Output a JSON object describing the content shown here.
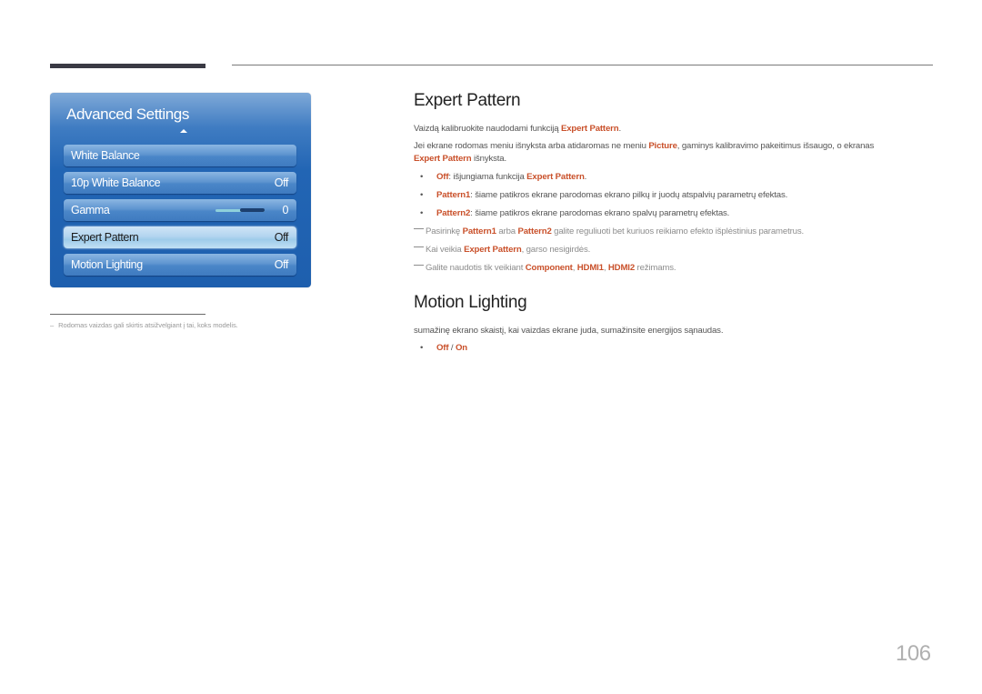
{
  "menu": {
    "title": "Advanced Settings",
    "items": [
      {
        "label": "White Balance",
        "value": ""
      },
      {
        "label": "10p White Balance",
        "value": "Off"
      },
      {
        "label": "Gamma",
        "value": "0",
        "slider_fraction": 0.5
      },
      {
        "label": "Expert Pattern",
        "value": "Off",
        "selected": true
      },
      {
        "label": "Motion Lighting",
        "value": "Off"
      }
    ]
  },
  "footnote": {
    "dash": "–",
    "text": "Rodomas vaizdas gali skirtis atsižvelgiant į tai, koks modelis."
  },
  "expert_pattern": {
    "heading": "Expert Pattern",
    "intro": {
      "pre": "Vaizdą kalibruokite naudodami funkciją ",
      "hl": "Expert Pattern",
      "post": "."
    },
    "para2": {
      "pre": "Jei ekrane rodomas meniu išnyksta arba atidaromas ne meniu ",
      "hl1": "Picture",
      "mid": ", gaminys kalibravimo pakeitimus išsaugo, o ekranas",
      "hl2": "Expert Pattern",
      "post": " išnyksta."
    },
    "bullets": [
      {
        "hl": "Off",
        "text": ": išjungiama funkcija ",
        "hl2": "Expert Pattern",
        "post": "."
      },
      {
        "hl": "Pattern1",
        "text": ": šiame patikros ekrane parodomas ekrano pilkų ir juodų atspalvių parametrų efektas."
      },
      {
        "hl": "Pattern2",
        "text": ": šiame patikros ekrane parodomas ekrano spalvų parametrų efektas."
      }
    ],
    "notes": [
      {
        "pre": "Pasirinkę ",
        "hl1": "Pattern1",
        "mid": " arba ",
        "hl2": "Pattern2",
        "post": " galite reguliuoti bet kuriuos reikiamo efekto išplėstinius parametrus."
      },
      {
        "pre": "Kai veikia ",
        "hl1": "Expert Pattern",
        "post": ", garso nesigirdės."
      },
      {
        "pre": "Galite naudotis tik veikiant ",
        "hl1": "Component",
        "sep1": ", ",
        "hl2": "HDMI1",
        "sep2": ", ",
        "hl3": "HDMI2",
        "post": " režimams."
      }
    ]
  },
  "motion_lighting": {
    "heading": "Motion Lighting",
    "desc": "sumažinę ekrano skaistį, kai vaizdas ekrane juda, sumažinsite energijos sąnaudas.",
    "options": {
      "off": "Off",
      "sep": " / ",
      "on": "On"
    }
  },
  "page_number": "106",
  "colors": {
    "accent": "#c9502a",
    "menu_blue": "#2265b4",
    "selected_item": "#b3d5ef"
  }
}
